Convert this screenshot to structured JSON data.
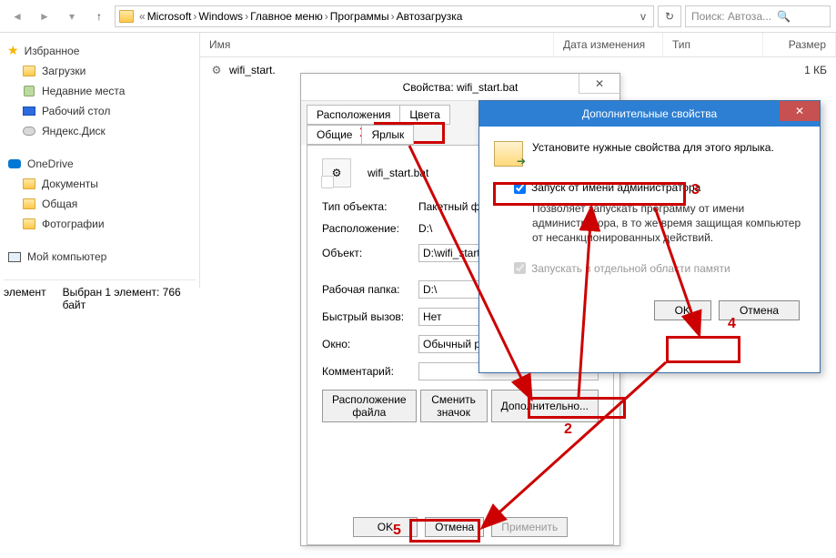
{
  "toolbar": {
    "breadcrumbs": [
      "Microsoft",
      "Windows",
      "Главное меню",
      "Программы",
      "Автозагрузка"
    ],
    "search_placeholder": "Поиск: Автоза..."
  },
  "sidebar": {
    "favorites": "Избранное",
    "fav_items": [
      "Загрузки",
      "Недавние места",
      "Рабочий стол",
      "Яндекс.Диск"
    ],
    "onedrive": "OneDrive",
    "od_items": [
      "Документы",
      "Общая",
      "Фотографии"
    ],
    "computer": "Мой компьютер"
  },
  "columns": {
    "name": "Имя",
    "date": "Дата изменения",
    "type": "Тип",
    "size": "Размер"
  },
  "file_row": {
    "name": "wifi_start.",
    "size": "1 КБ"
  },
  "status": {
    "elements": "элемент",
    "selected": "Выбран 1 элемент: 766 байт"
  },
  "props": {
    "title": "Свойства: wifi_start.bat",
    "tabs_row1": [
      "Расположения",
      "Цвета"
    ],
    "tabs_row2": [
      "Общие",
      "Ярлык"
    ],
    "filename": "wifi_start.bat",
    "fields": {
      "type_obj_label": "Тип объекта:",
      "type_obj_val": "Пакетный файл",
      "location_label": "Расположение:",
      "location_val": "D:\\",
      "object_label": "Объект:",
      "object_val": "D:\\wifi_start.bat",
      "workdir_label": "Рабочая папка:",
      "workdir_val": "D:\\",
      "hotkey_label": "Быстрый вызов:",
      "hotkey_val": "Нет",
      "window_label": "Окно:",
      "window_val": "Обычный разм",
      "comment_label": "Комментарий:"
    },
    "buttons": {
      "file_loc": "Расположение файла",
      "change_icon": "Сменить значок",
      "advanced": "Дополнительно..."
    },
    "footer": {
      "ok": "OK",
      "cancel": "Отмена",
      "apply": "Применить"
    }
  },
  "adv": {
    "title": "Дополнительные свойства",
    "hdr_text": "Установите нужные свойства для этого ярлыка.",
    "run_admin": "Запуск от имени администратора",
    "desc": "Позволяет запускать программу от имени администратора, в то же время защищая компьютер от несанкционированных действий.",
    "mem": "Запускать в отдельной области памяти",
    "ok": "OK",
    "cancel": "Отмена"
  },
  "annotations": {
    "n1": "1",
    "n2": "2",
    "n3": "3",
    "n4": "4",
    "n5": "5"
  }
}
